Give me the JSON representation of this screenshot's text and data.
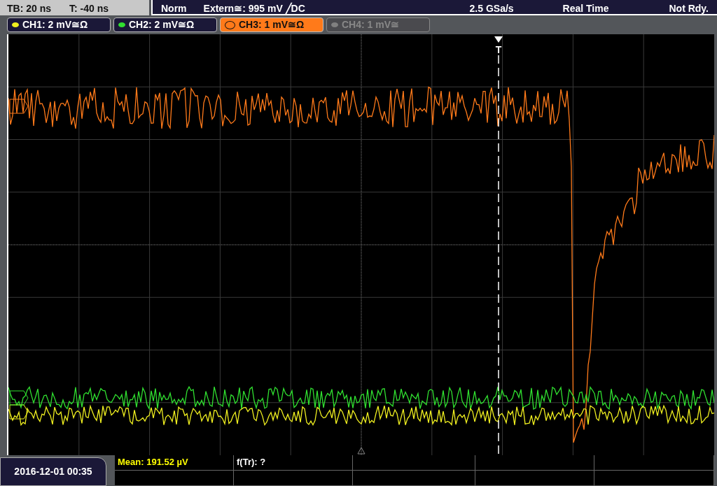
{
  "status_left": {
    "timebase": "TB: 20 ns",
    "trigger_offset": "T: -40 ns"
  },
  "status_right": {
    "mode": "Norm",
    "trigger": "Extern≅: 995 mV ╱DC",
    "sample_rate": "2.5 GSa/s",
    "acquisition": "Real Time",
    "state": "Not Rdy."
  },
  "channels": [
    {
      "label": "CH1: 2 mV≅Ω",
      "color": "#f0f020",
      "selected": false,
      "on": true
    },
    {
      "label": "CH2: 2 mV≅Ω",
      "color": "#30e030",
      "selected": false,
      "on": true
    },
    {
      "label": "CH3: 1 mV≅Ω",
      "color": "#ff7a1a",
      "selected": true,
      "on": true
    },
    {
      "label": "CH4: 1 mV≅",
      "color": "#808080",
      "selected": false,
      "on": false
    }
  ],
  "trigger_marker": "T",
  "date": "2016-12-01 00:35",
  "measurements": [
    {
      "text": "Mean: 191.52 µV",
      "kind": "value"
    },
    {
      "text": "f(Tr): ?",
      "kind": "plain"
    }
  ]
}
